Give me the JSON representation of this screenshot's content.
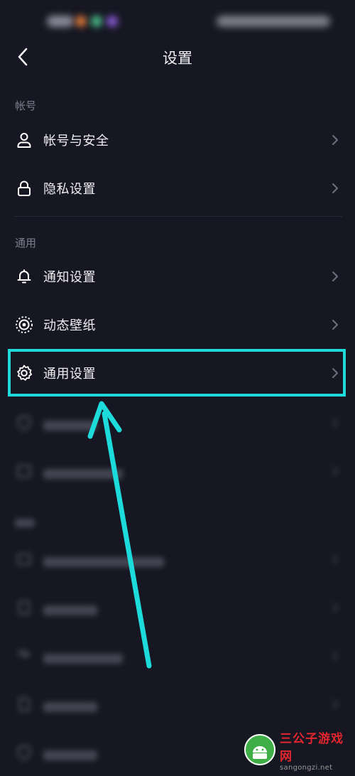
{
  "header": {
    "title": "设置"
  },
  "sections": {
    "account": {
      "label": "帐号",
      "items": [
        {
          "label": "帐号与安全",
          "icon": "person-icon"
        },
        {
          "label": "隐私设置",
          "icon": "lock-icon"
        }
      ]
    },
    "general": {
      "label": "通用",
      "items": [
        {
          "label": "通知设置",
          "icon": "bell-icon"
        },
        {
          "label": "动态壁纸",
          "icon": "live-wallpaper-icon"
        },
        {
          "label": "通用设置",
          "icon": "gear-icon"
        }
      ]
    }
  },
  "highlight_color": "#1ddbdb",
  "watermark": {
    "title": "三公子游戏网",
    "url": "sangongzi.net"
  }
}
